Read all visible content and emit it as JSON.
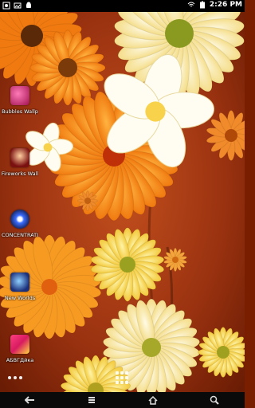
{
  "status_bar": {
    "time": "2:26 PM",
    "left_icons": [
      "wallpaper-icon",
      "image-icon",
      "android-icon"
    ],
    "right_icons": [
      "wifi-icon",
      "battery-icon"
    ]
  },
  "shortcuts": [
    {
      "name": "bubbles",
      "label": "Bubbles Wallp",
      "icon": "bubbles-icon",
      "color": "#c2186b"
    },
    {
      "name": "fireworks",
      "label": "Fireworks Wall",
      "icon": "fireworks-icon",
      "color": "#8b1c1c"
    },
    {
      "name": "concentration",
      "label": "CONCENTRATI",
      "icon": "eye-icon",
      "color": "#2a3a8a"
    },
    {
      "name": "new-worlds",
      "label": "New Worlds",
      "icon": "planet-icon",
      "color": "#1b2f7a"
    },
    {
      "name": "abvgdeyka",
      "label": "АБВГДйка",
      "icon": "abc-blocks-icon",
      "color": "#d81b60"
    }
  ],
  "navigation": [
    "back-icon",
    "menu-icon",
    "home-icon",
    "search-icon"
  ],
  "page_indicator": {
    "count": 3
  }
}
